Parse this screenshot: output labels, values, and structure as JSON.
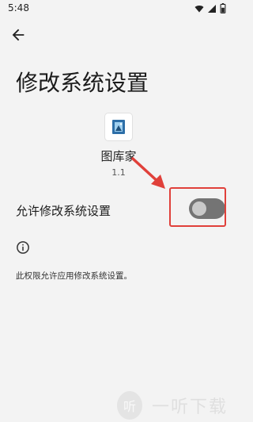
{
  "status": {
    "time": "5:48"
  },
  "page": {
    "title": "修改系统设置"
  },
  "app": {
    "name": "图库家",
    "version": "1.1"
  },
  "setting": {
    "label": "允许修改系统设置",
    "enabled": false
  },
  "info": {
    "text": "此权限允许应用修改系统设置。"
  },
  "watermark": {
    "text": "一听下载"
  },
  "colors": {
    "accent": "#e0403a",
    "toggle_track": "#747474",
    "toggle_knob": "#c9c9c9",
    "background": "#f3f3f3"
  }
}
